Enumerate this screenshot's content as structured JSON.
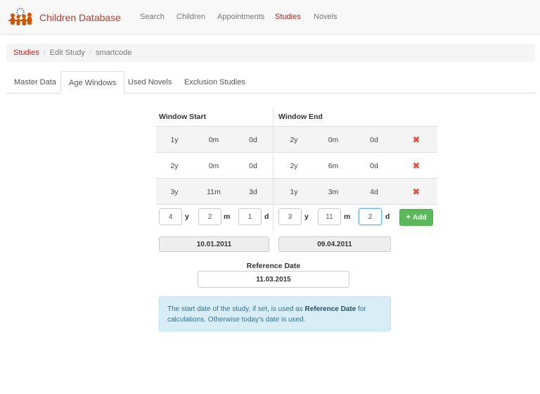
{
  "navbar": {
    "brand": "Children Database",
    "links": [
      {
        "label": "Search",
        "active": false
      },
      {
        "label": "Children",
        "active": false
      },
      {
        "label": "Appointments",
        "active": false
      },
      {
        "label": "Studies",
        "active": true
      },
      {
        "label": "Novels",
        "active": false
      }
    ]
  },
  "breadcrumb": {
    "items": [
      "Studies",
      "Edit Study",
      "smartcode"
    ],
    "separator": "/"
  },
  "tabs": [
    {
      "label": "Master Data",
      "active": false
    },
    {
      "label": "Age Windows",
      "active": true
    },
    {
      "label": "Used Novels",
      "active": false
    },
    {
      "label": "Exclusion Studies",
      "active": false
    }
  ],
  "table": {
    "headers": {
      "start": "Window Start",
      "end": "Window End"
    },
    "rows": [
      {
        "start": [
          "1y",
          "0m",
          "0d"
        ],
        "end": [
          "2y",
          "0m",
          "0d"
        ]
      },
      {
        "start": [
          "2y",
          "0m",
          "0d"
        ],
        "end": [
          "2y",
          "6m",
          "0d"
        ]
      },
      {
        "start": [
          "3y",
          "11m",
          "3d"
        ],
        "end": [
          "1y",
          "3m",
          "4d"
        ]
      }
    ],
    "delete_glyph": "✖"
  },
  "new_window": {
    "start": {
      "y": "4",
      "m": "2",
      "d": "1"
    },
    "end": {
      "y": "3",
      "m": "11",
      "d": "2"
    },
    "units": {
      "y": "y",
      "m": "m",
      "d": "d"
    },
    "add_label": "Add",
    "add_icon": "+",
    "start_date": "10.01.2011",
    "end_date": "09.04.2011"
  },
  "reference": {
    "label": "Reference Date",
    "value": "11.03.2015"
  },
  "info": {
    "before": "The start date of the study, if set, is used as ",
    "strong": "Reference Date",
    "after": " for calculations. Otherwise today's date is used."
  },
  "colors": {
    "accent": "#b3261e",
    "success": "#5cb85c",
    "danger": "#e74c3c",
    "info_bg": "#d9edf7"
  }
}
